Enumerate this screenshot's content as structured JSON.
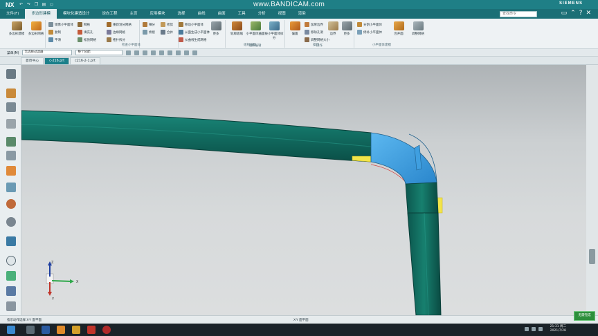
{
  "titlebar": {
    "app": "NX",
    "recorder_watermark": "www.BANDICAM.com",
    "brand": "SIEMENS",
    "quick_access_icons": [
      "undo-icon",
      "redo-icon",
      "copy-icon",
      "paste-icon",
      "window-icon"
    ]
  },
  "menu": {
    "tabs": [
      "文件(F)",
      "多边形建模",
      "模块化建造设计",
      "逆向工程",
      "主页",
      "应用模块",
      "选择",
      "曲线",
      "曲面",
      "工具",
      "分析",
      "视图",
      "渲染"
    ],
    "active_index": 1,
    "search_placeholder": "查找命令"
  },
  "ribbon": {
    "groups": [
      {
        "title": "",
        "big": [
          "多边形建模",
          "多边形网格"
        ],
        "small": []
      },
      {
        "title": "",
        "small_col1": [
          "镜像小平面体",
          "复制",
          "平滑"
        ],
        "small_col2": [
          "网格",
          "填充孔",
          "松弛网格"
        ],
        "small_col3": [
          "重新划分网格",
          "边缘网格",
          "拓扑拆分"
        ]
      },
      {
        "title": "",
        "small_col1": [
          "细分",
          "桥接"
        ],
        "small_col2": [
          "修剪",
          "合并"
        ]
      },
      {
        "title": "",
        "big": [
          "更多"
        ],
        "small_col1": [
          "移动小平面体",
          "从面生成小平面体"
        ],
        "small_col2": [
          "从曲线生成网格",
          "构造面体"
        ]
      },
      {
        "title": "组织编辑",
        "big": [
          "轮廓收缩",
          "小平面体曲面",
          "按小平面体拆分"
        ]
      },
      {
        "title": "操作",
        "big": [
          "偏置",
          "边界",
          "更多"
        ],
        "small_col1": [
          "加厚边界",
          "移除孔洞",
          "调整网格大小"
        ]
      },
      {
        "title": "",
        "small_col1": [
          "分割小平面体",
          "修补小平面体"
        ],
        "big": [
          "合并面",
          "调整网格"
        ]
      }
    ],
    "section_labels": [
      "检查小平面体",
      "组织编辑",
      "操作",
      "小平面体建模"
    ]
  },
  "selection_bar": {
    "menu_label": "菜单(M)",
    "filter_value": "无选择过滤器",
    "scope_value": "整个装配"
  },
  "doc_tabs": [
    {
      "label": "首页中心",
      "active": false
    },
    {
      "label": "c-216.prt",
      "active": true
    },
    {
      "label": "c216-2-1.prt",
      "active": false
    }
  ],
  "left_icons": [
    "part-navigator-icon",
    "assembly-icon",
    "history-icon",
    "constraint-icon",
    "role-icon",
    "web-icon",
    "layer-icon",
    "palette-icon",
    "sphere-icon",
    "view-icon",
    "clock-icon",
    "analysis-icon",
    "measure-icon",
    "dimension-icon"
  ],
  "viewport": {
    "triad_axes": [
      "Z",
      "Y",
      "X"
    ]
  },
  "status": {
    "left_text": "指示动作选择 X-Y 面平面",
    "mid_text": "X-Y 面平面"
  },
  "taskbar": {
    "time": "21:31 周二",
    "date": "2021/7/28",
    "notify_label": "无需完成"
  },
  "colors": {
    "titlebar": "#1f7f86",
    "active_tab": "#1b7f8a",
    "pipe": "#11695f",
    "selected_face": "#3a9be0",
    "highlight_edge": "#f2e44a"
  }
}
